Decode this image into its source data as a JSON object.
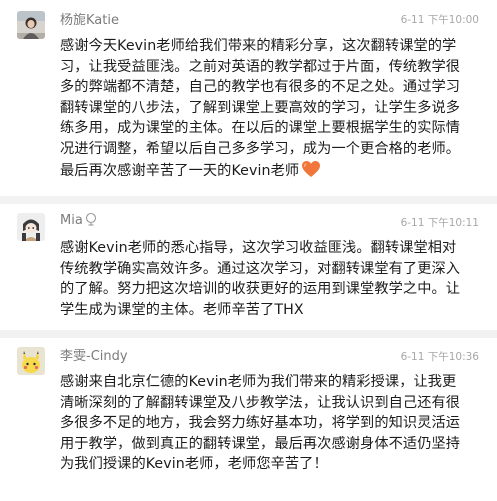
{
  "comments": [
    {
      "name": "杨旎Katie",
      "time": "6-11 下午10:00",
      "lines": [
        "感谢今天Kevin老师给我们带来的精彩分享，这次翻转课堂的学",
        "习，让我受益匪浅。之前对英语的教学都过于片面，传统教学很",
        "多的弊端都不清楚，自己的教学也有很多的不足之处。通过学习",
        "翻转课堂的八步法，了解到课堂上要高效的学习，让学生多说多",
        "练多用，成为课堂的主体。在以后的课堂上要根据学生的实际情",
        "况进行调整，希望以后自己多多学习，成为一个更合格的老师。",
        "最后再次感谢辛苦了一天的Kevin老师"
      ],
      "emoji_icon": "orange-heart-icon"
    },
    {
      "name": "Mia",
      "name_icon": "voice-icon",
      "time": "6-11 下午10:11",
      "lines": [
        "感谢Kevin老师的悉心指导，这次学习收益匪浅。翻转课堂相对",
        "传统教学确实高效许多。通过这次学习，对翻转课堂有了更深入",
        "的了解。努力把这次培训的收获更好的运用到课堂教学之中。让",
        "学生成为课堂的主体。老师辛苦了THX"
      ]
    },
    {
      "name": "李雯-Cindy",
      "time": "6-11 下午10:36",
      "lines": [
        "感谢来自北京仁德的Kevin老师为我们带来的精彩授课，让我更",
        "清晰深刻的了解翻转课堂及八步教学法，让我认识到自己还有很",
        "多很多不足的地方，我会努力练好基本功，将学到的知识灵活运",
        "用于教学，做到真正的翻转课堂，最后再次感谢身体不适仍坚持",
        "为我们授课的Kevin老师，老师您辛苦了！"
      ]
    }
  ],
  "colors": {
    "name": "#7b7b7b",
    "time": "#a8a8a8",
    "text": "#1c1c1c",
    "divider": "#f2f2f2",
    "heart": "#f0763b"
  }
}
